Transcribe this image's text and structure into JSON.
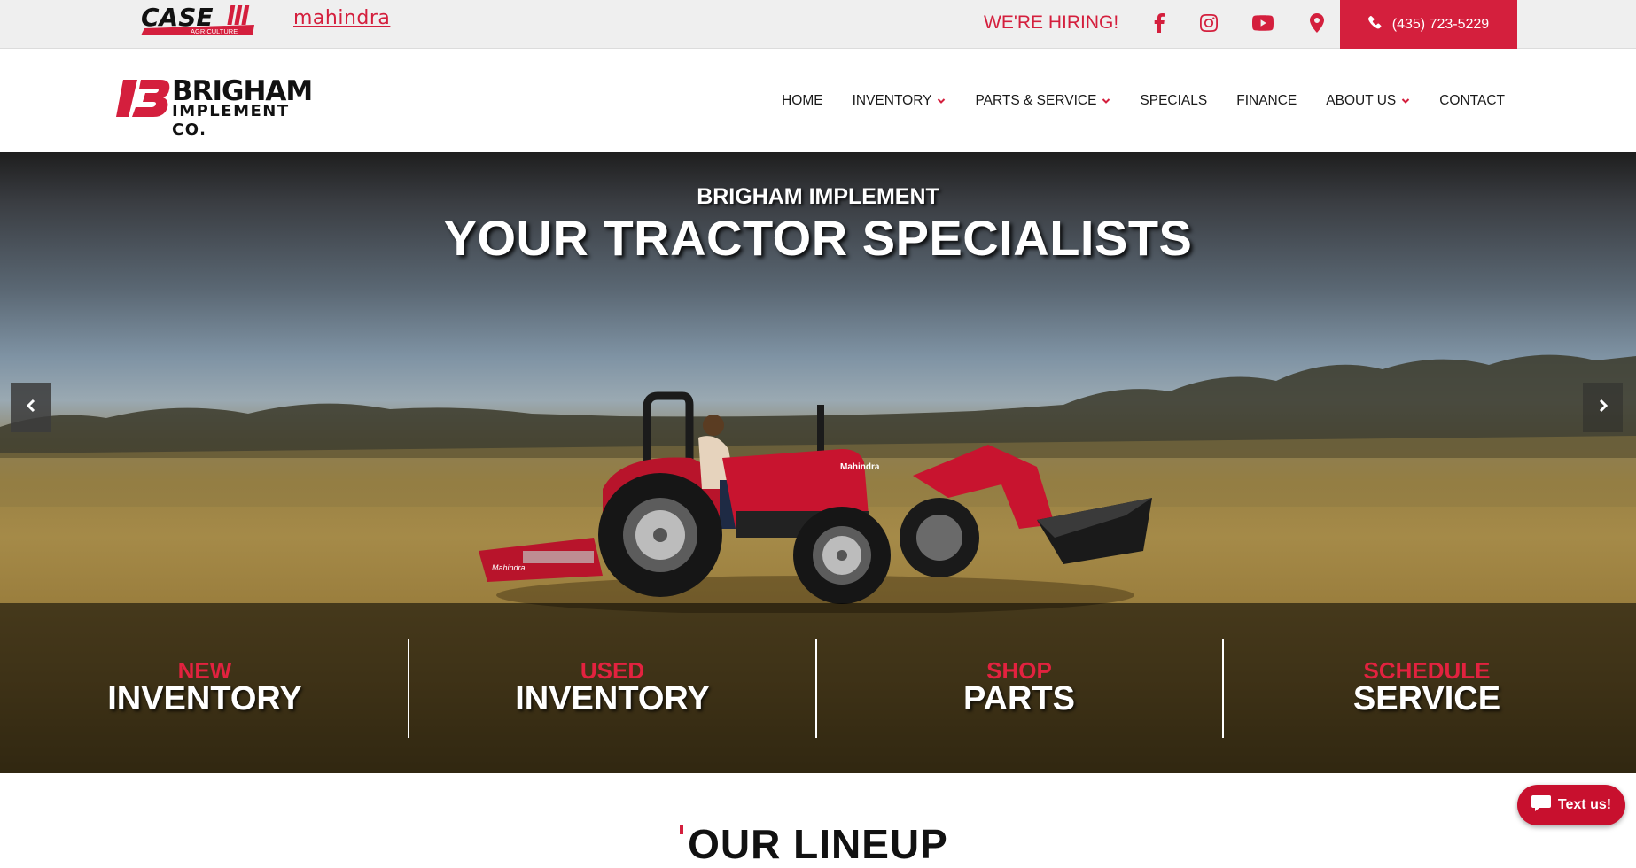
{
  "topbar": {
    "case_logo": {
      "brand": "CASE",
      "sub": "AGRICULTURE"
    },
    "mahindra_logo": "mahindra",
    "hiring_link": "WE'RE HIRING!",
    "social": [
      {
        "name": "facebook",
        "icon": "facebook-icon"
      },
      {
        "name": "instagram",
        "icon": "instagram-icon"
      },
      {
        "name": "youtube",
        "icon": "youtube-icon"
      },
      {
        "name": "location",
        "icon": "map-pin-icon"
      }
    ],
    "phone": "(435) 723-5229"
  },
  "header": {
    "brand_line1": "BRIGHAM",
    "brand_line2": "IMPLEMENT CO.",
    "nav": [
      {
        "label": "HOME",
        "dropdown": false
      },
      {
        "label": "INVENTORY",
        "dropdown": true
      },
      {
        "label": "PARTS & SERVICE",
        "dropdown": true
      },
      {
        "label": "SPECIALS",
        "dropdown": false
      },
      {
        "label": "FINANCE",
        "dropdown": false
      },
      {
        "label": "ABOUT US",
        "dropdown": true
      },
      {
        "label": "CONTACT",
        "dropdown": false
      }
    ]
  },
  "hero": {
    "subtitle": "BRIGHAM IMPLEMENT",
    "title": "YOUR TRACTOR SPECIALISTS",
    "tractor_brand": "Mahindra",
    "ctas": [
      {
        "kicker": "NEW",
        "main": "INVENTORY"
      },
      {
        "kicker": "USED",
        "main": "INVENTORY"
      },
      {
        "kicker": "SHOP",
        "main": "PARTS"
      },
      {
        "kicker": "SCHEDULE",
        "main": "SERVICE"
      }
    ]
  },
  "section": {
    "heading": "OUR LINEUP"
  },
  "chat_widget": {
    "label": "Text us!"
  },
  "colors": {
    "accent": "#d41f3d",
    "topbar_bg": "#efefef",
    "text": "#1a1a1a"
  }
}
